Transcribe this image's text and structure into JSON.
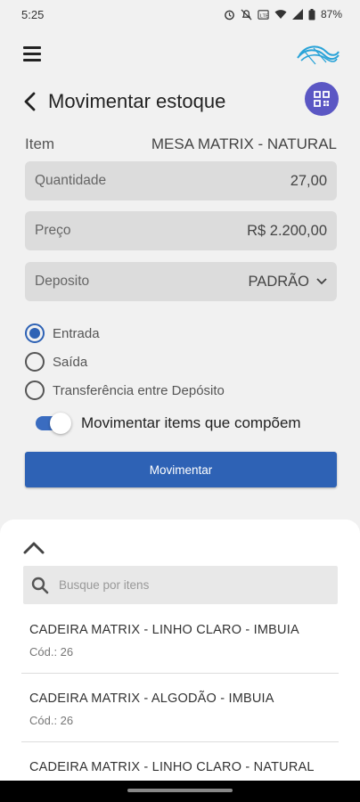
{
  "status_bar": {
    "time": "5:25",
    "battery": "87%",
    "icons": [
      "alarm-icon",
      "muted-notification-icon",
      "data-saver-icon",
      "wifi-icon",
      "signal-icon",
      "battery-icon"
    ]
  },
  "header": {
    "menu_icon": "hamburger-menu-icon",
    "logo_icon": "brand-logo-icon"
  },
  "title": {
    "back_icon": "chevron-left-icon",
    "text": "Movimentar estoque",
    "qr_icon": "qr-code-icon"
  },
  "item": {
    "label": "Item",
    "value": "MESA MATRIX - NATURAL"
  },
  "fields": {
    "quantidade": {
      "label": "Quantidade",
      "value": "27,00"
    },
    "preco": {
      "label": "Preço",
      "value": "R$ 2.200,00"
    },
    "deposito": {
      "label": "Deposito",
      "value": "PADRÃO",
      "icon": "chevron-down-icon"
    }
  },
  "radios": [
    {
      "label": "Entrada",
      "checked": true
    },
    {
      "label": "Saída",
      "checked": false
    },
    {
      "label": "Transferência entre Depósito",
      "checked": false
    }
  ],
  "toggle": {
    "label": "Movimentar items que compõem",
    "on": true
  },
  "primary_button": {
    "label": "Movimentar"
  },
  "sheet": {
    "collapse_icon": "chevron-up-icon",
    "search": {
      "placeholder": "Busque por itens",
      "value": ""
    },
    "items": [
      {
        "name": "CADEIRA MATRIX - LINHO CLARO - IMBUIA",
        "code": "Cód.: 26"
      },
      {
        "name": "CADEIRA MATRIX - ALGODÃO - IMBUIA",
        "code": "Cód.: 26"
      },
      {
        "name": "CADEIRA MATRIX - LINHO CLARO - NATURAL",
        "code": ""
      }
    ]
  },
  "colors": {
    "accent": "#2e62b5",
    "qr_button": "#5b57c4",
    "field_bg": "#dcdcdc",
    "background": "#f1f1f1"
  }
}
